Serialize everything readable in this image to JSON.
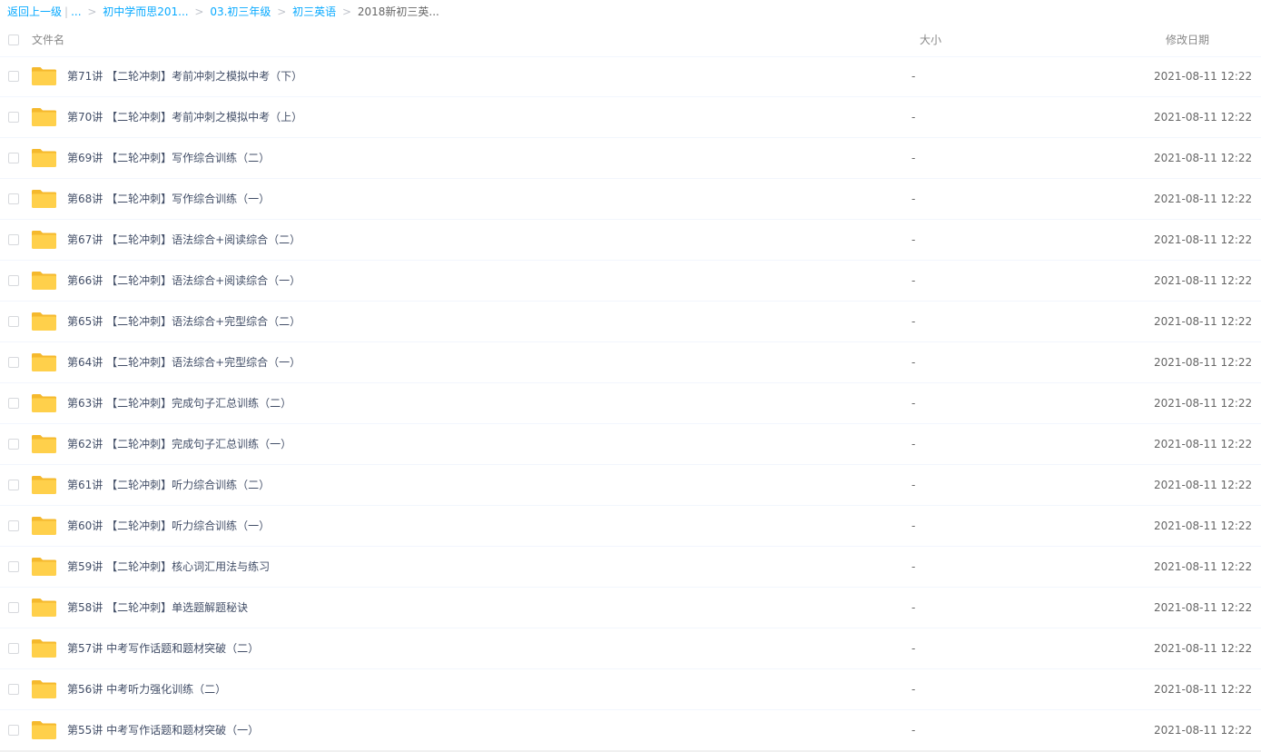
{
  "breadcrumb": {
    "back": "返回上一级",
    "bar": "|",
    "ellipsis": "...",
    "sep": ">",
    "crumbs": [
      "初中学而思201...",
      "03.初三年级",
      "初三英语"
    ],
    "current": "2018新初三英..."
  },
  "header": {
    "name": "文件名",
    "size": "大小",
    "date": "修改日期"
  },
  "colors": {
    "link": "#09aaff",
    "folder": "#ffd04b",
    "folder_tab": "#f5b92d",
    "row_border": "#f2f6fd"
  },
  "icons": {
    "row": "folder-icon"
  },
  "files": [
    {
      "name": "第71讲 【二轮冲刺】考前冲刺之模拟中考（下）",
      "size": "-",
      "date": "2021-08-11 12:22"
    },
    {
      "name": "第70讲 【二轮冲刺】考前冲刺之模拟中考（上）",
      "size": "-",
      "date": "2021-08-11 12:22"
    },
    {
      "name": "第69讲 【二轮冲刺】写作综合训练（二）",
      "size": "-",
      "date": "2021-08-11 12:22"
    },
    {
      "name": "第68讲 【二轮冲刺】写作综合训练（一）",
      "size": "-",
      "date": "2021-08-11 12:22"
    },
    {
      "name": "第67讲 【二轮冲刺】语法综合+阅读综合（二）",
      "size": "-",
      "date": "2021-08-11 12:22"
    },
    {
      "name": "第66讲 【二轮冲刺】语法综合+阅读综合（一）",
      "size": "-",
      "date": "2021-08-11 12:22"
    },
    {
      "name": "第65讲 【二轮冲刺】语法综合+完型综合（二）",
      "size": "-",
      "date": "2021-08-11 12:22"
    },
    {
      "name": "第64讲 【二轮冲刺】语法综合+完型综合（一）",
      "size": "-",
      "date": "2021-08-11 12:22"
    },
    {
      "name": "第63讲 【二轮冲刺】完成句子汇总训练（二）",
      "size": "-",
      "date": "2021-08-11 12:22"
    },
    {
      "name": "第62讲 【二轮冲刺】完成句子汇总训练（一）",
      "size": "-",
      "date": "2021-08-11 12:22"
    },
    {
      "name": "第61讲 【二轮冲刺】听力综合训练（二）",
      "size": "-",
      "date": "2021-08-11 12:22"
    },
    {
      "name": "第60讲 【二轮冲刺】听力综合训练（一）",
      "size": "-",
      "date": "2021-08-11 12:22"
    },
    {
      "name": "第59讲 【二轮冲刺】核心词汇用法与练习",
      "size": "-",
      "date": "2021-08-11 12:22"
    },
    {
      "name": "第58讲 【二轮冲刺】单选题解题秘诀",
      "size": "-",
      "date": "2021-08-11 12:22"
    },
    {
      "name": "第57讲 中考写作话题和题材突破（二）",
      "size": "-",
      "date": "2021-08-11 12:22"
    },
    {
      "name": "第56讲 中考听力强化训练（二）",
      "size": "-",
      "date": "2021-08-11 12:22"
    },
    {
      "name": "第55讲 中考写作话题和题材突破（一）",
      "size": "-",
      "date": "2021-08-11 12:22"
    }
  ]
}
